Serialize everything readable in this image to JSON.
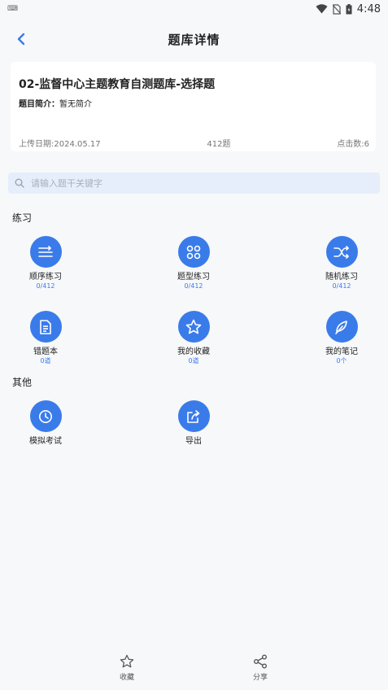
{
  "status_bar": {
    "time": "4:48",
    "left_indicator": "⌨"
  },
  "header": {
    "title": "题库详情"
  },
  "bank": {
    "title": "02-监督中心主题教育自测题库-选择题",
    "intro_label": "题目简介：",
    "intro_value": "暂无简介",
    "upload_date": "上传日期:2024.05.17",
    "question_count": "412题",
    "clicks": "点击数:6"
  },
  "search": {
    "placeholder": "请输入题干关键字"
  },
  "practice": {
    "title": "练习",
    "items": [
      {
        "label": "顺序练习",
        "count": "0/412",
        "icon": "list-icon"
      },
      {
        "label": "题型练习",
        "count": "0/412",
        "icon": "grid-icon"
      },
      {
        "label": "随机练习",
        "count": "0/412",
        "icon": "shuffle-icon"
      },
      {
        "label": "错题本",
        "count": "0道",
        "icon": "notebook-icon"
      },
      {
        "label": "我的收藏",
        "count": "0道",
        "icon": "star-icon"
      },
      {
        "label": "我的笔记",
        "count": "0个",
        "icon": "pen-icon"
      }
    ]
  },
  "other": {
    "title": "其他",
    "items": [
      {
        "label": "模拟考试",
        "icon": "clock-icon"
      },
      {
        "label": "导出",
        "icon": "export-icon"
      }
    ]
  },
  "bottom": {
    "favorite_label": "收藏",
    "share_label": "分享"
  },
  "colors": {
    "accent": "#3a7bea",
    "search_bg": "#e6eefb",
    "page_bg": "#f7f8fa"
  }
}
